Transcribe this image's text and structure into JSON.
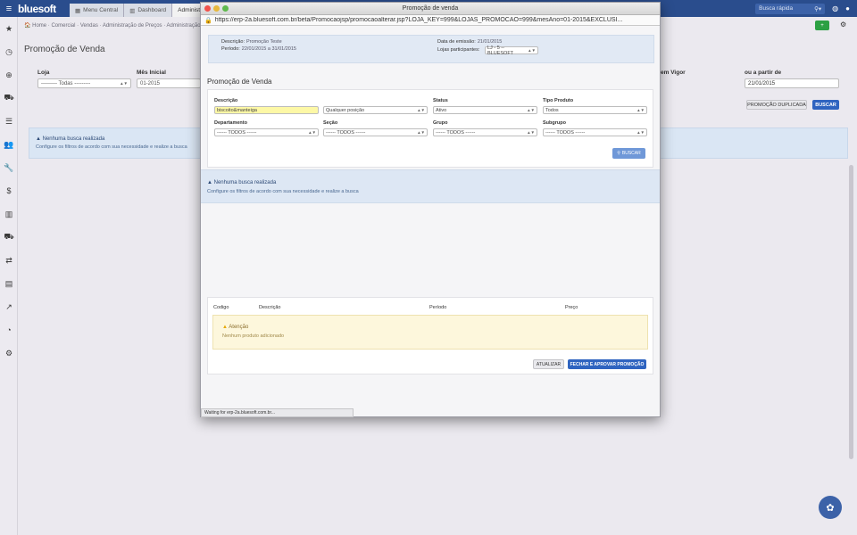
{
  "topbar": {
    "logo": "bluesoft",
    "tabs": [
      {
        "label": "Menu Central",
        "icon": "grid-icon"
      },
      {
        "label": "Dashboard",
        "icon": "chart-icon"
      },
      {
        "label": "Administraç",
        "icon": ""
      }
    ],
    "quick_search": "Busca rápida"
  },
  "breadcrumb": "🏠 Home · Comercial · Vendas · Administração de Preços · Administração",
  "page": {
    "title": "Promoção de Venda",
    "loja_label": "Loja",
    "loja_value": "--------- Todas ---------",
    "mes_label": "Mês Inicial",
    "mes_value": "01-2015",
    "vigor_label": "em Vigor",
    "apartir_label": "ou a partir de",
    "apartir_value": "21/01/2015",
    "btn_duplicada": "PROMOÇÃO DUPLICADA",
    "btn_buscar": "BUSCAR",
    "info_title": "Nenhuma busca realizada",
    "info_sub": "Configure os filtros de acordo com sua necessidade e realize a busca"
  },
  "popup": {
    "window_title": "Promoção de venda",
    "url": "https://erp-2a.bluesoft.com.br/beta/Promocaojsp/promocaoalterar.jsp?LOJA_KEY=999&LOJAS_PROMOCAO=999&mesAno=01-2015&EXCLUSI...",
    "summary": {
      "descricao_label": "Descrição:",
      "descricao_value": "Promoção Teste",
      "periodo_label": "Período:",
      "periodo_value": "22/01/2015 a 31/01/2015",
      "emissao_label": "Data de emissão:",
      "emissao_value": "21/01/2015",
      "lojas_label": "Lojas participantes:",
      "lojas_value": "LJ - 5 -- BLUESOFT"
    },
    "section_title": "Promoção de Venda",
    "form": {
      "descricao_label": "Descrição",
      "descricao_value": "biscoito&manteiga",
      "posicao_value": "Qualquer posição",
      "status_label": "Status",
      "status_value": "Ativo",
      "tipo_label": "Tipo Produto",
      "tipo_value": "Todos",
      "departamento_label": "Departamento",
      "departamento_value": "------ TODOS ------",
      "secao_label": "Seção",
      "secao_value": "------ TODOS ------",
      "grupo_label": "Grupo",
      "grupo_value": "------ TODOS ------",
      "subgrupo_label": "Subgrupo",
      "subgrupo_value": "------ TODOS ------",
      "buscar": "BUSCAR"
    },
    "info_title": "Nenhuma busca realizada",
    "info_sub": "Configure os filtros de acordo com sua necessidade e realize a busca",
    "table": {
      "columns": [
        "Codigo",
        "Descrição",
        "Período",
        "Preço"
      ],
      "warn_title": "Atenção",
      "warn_text": "Nenhum produto adicionado"
    },
    "btn_atualizar": "ATUALIZAR",
    "btn_fechar": "FECHAR E APROVAR PROMOÇÃO",
    "status_text": "Waiting for erp-2a.bluesoft.com.br..."
  },
  "colors": {
    "topbar": "#2a4d8d",
    "primary_button": "#2f64c0",
    "success": "#2ca043",
    "warning_bg": "#fdf7dc"
  }
}
